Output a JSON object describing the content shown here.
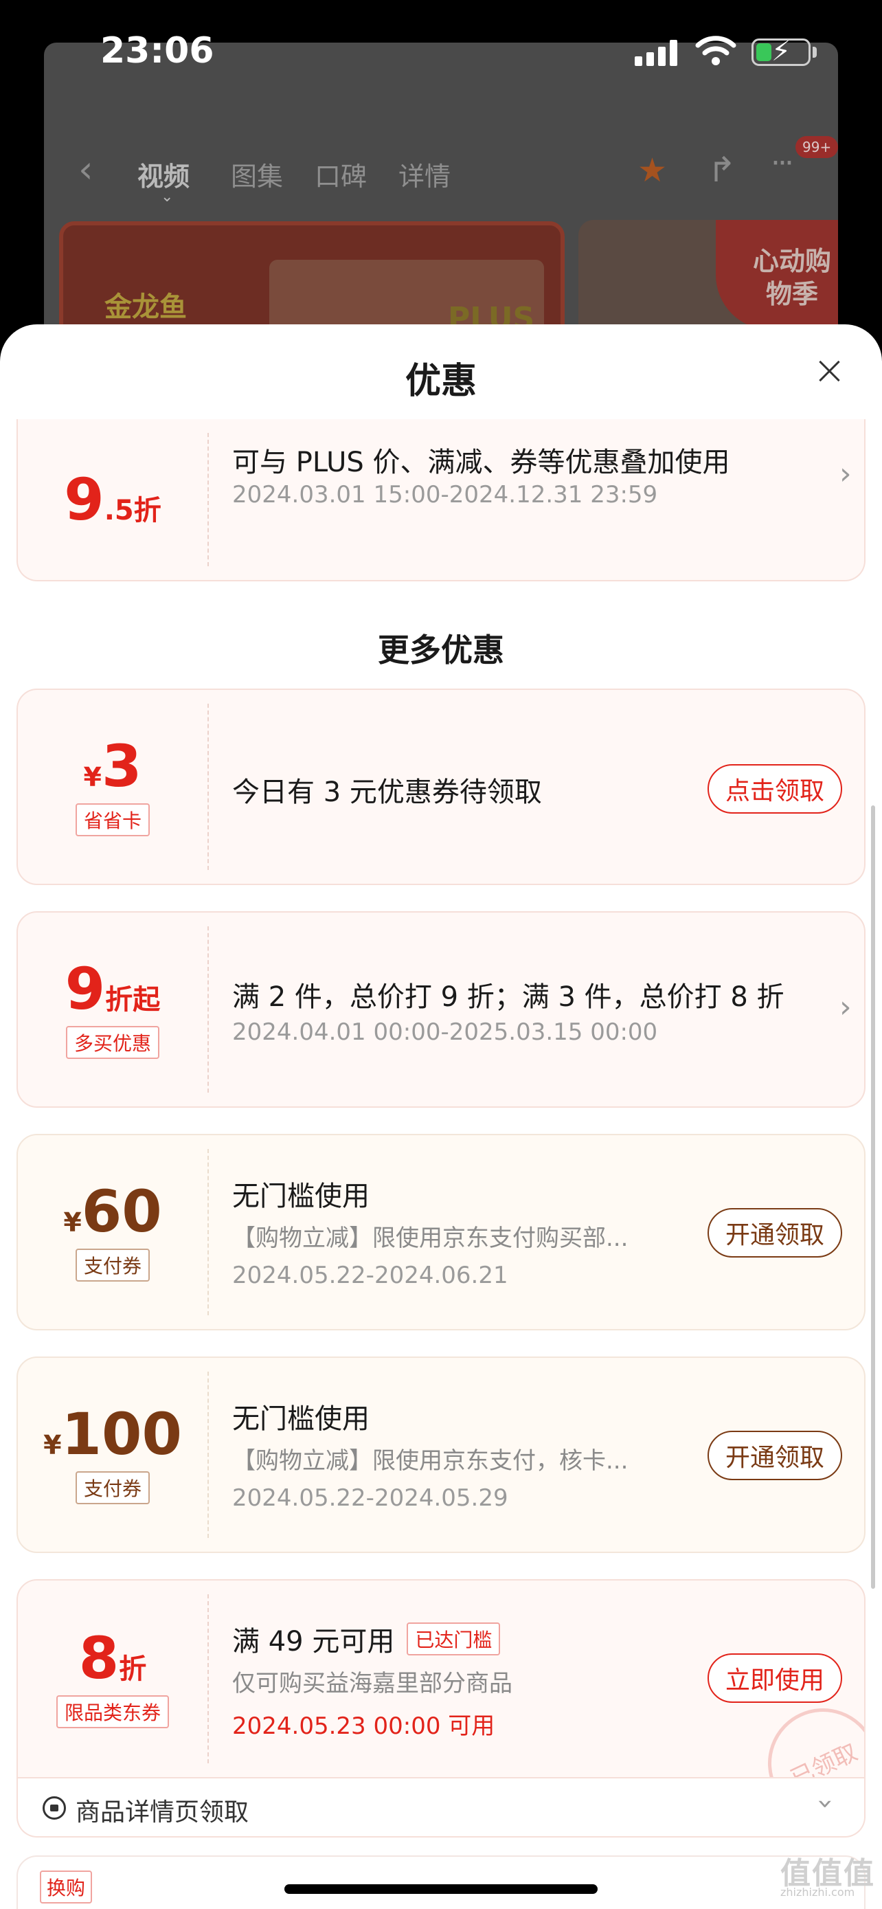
{
  "status_bar": {
    "time": "23:06"
  },
  "background": {
    "nav_tabs": [
      "视频",
      "图集",
      "口碑",
      "详情"
    ],
    "badge": "99+",
    "brand": "金龙鱼",
    "plus_text": "PLUS",
    "banner_text": "心动购物季"
  },
  "sheet": {
    "title": "优惠",
    "top_coupon": {
      "amount_big": "9",
      "amount_small": ".5折",
      "main": "可与 PLUS 价、满减、券等优惠叠加使用",
      "validity": "2024.03.01 15:00-2024.12.31 23:59"
    },
    "more_title": "更多优惠",
    "coupons": [
      {
        "symbol": "¥",
        "amount": "3",
        "suffix": "",
        "tag": "省省卡",
        "main": "今日有 3 元优惠券待领取",
        "button": "点击领取"
      },
      {
        "symbol": "",
        "amount": "9",
        "suffix": "折起",
        "tag": "多买优惠",
        "main": "满 2 件，总价打 9 折；满 3 件，总价打 8 折",
        "validity": "2024.04.01 00:00-2025.03.15 00:00"
      },
      {
        "symbol": "¥",
        "amount": "60",
        "suffix": "",
        "tag": "支付券",
        "main": "无门槛使用",
        "desc": "【购物立减】限使用京东支付购买部...",
        "validity": "2024.05.22-2024.06.21",
        "button": "开通领取"
      },
      {
        "symbol": "¥",
        "amount": "100",
        "suffix": "",
        "tag": "支付券",
        "main": "无门槛使用",
        "desc": "【购物立减】限使用京东支付，核卡...",
        "validity": "2024.05.22-2024.05.29",
        "button": "开通领取"
      },
      {
        "symbol": "",
        "amount": "8",
        "suffix": "折",
        "tag": "限品类东券",
        "main": "满 49 元可用",
        "reached": "已达门槛",
        "desc": "仅可购买益海嘉里部分商品",
        "validity": "2024.05.23 00:00 可用",
        "button": "立即使用",
        "stamp": "已领取"
      }
    ],
    "footer_label": "商品详情页领取",
    "next_tag": "换购"
  },
  "watermark": {
    "main": "值值值",
    "sub": "zhizhizhi.com"
  },
  "colors": {
    "accent": "#e2231a",
    "brown": "#7a3a14"
  }
}
